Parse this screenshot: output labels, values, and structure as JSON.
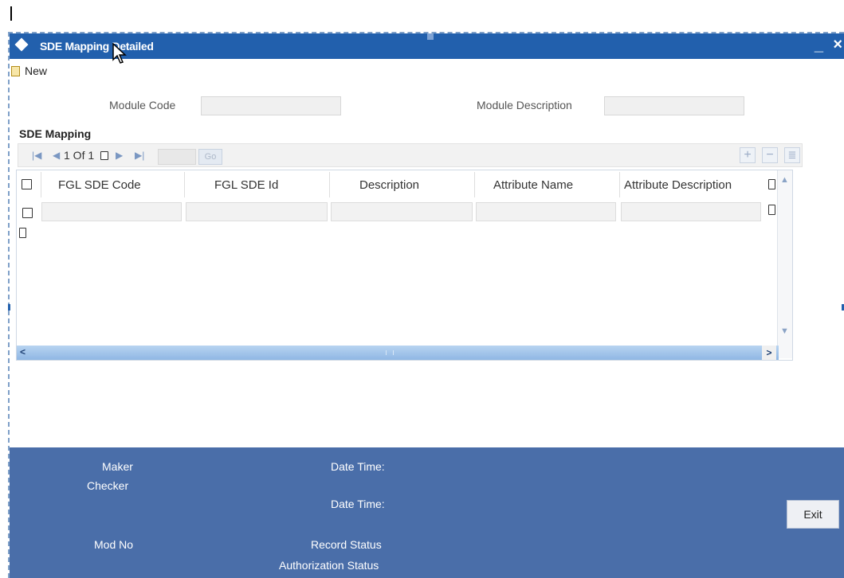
{
  "window": {
    "title": "SDE Mapping Detailed",
    "minimize": "_",
    "close": "×"
  },
  "toolbar": {
    "new_label": "New"
  },
  "form": {
    "module_code_label": "Module Code",
    "module_code_value": "",
    "module_description_label": "Module Description",
    "module_description_value": ""
  },
  "section": {
    "title": "SDE Mapping"
  },
  "pager": {
    "page_text": "1 Of 1",
    "page_input": "",
    "go_label": "Go",
    "add": "+",
    "remove": "−",
    "view": "≣"
  },
  "grid": {
    "columns": [
      "FGL SDE Code",
      "FGL SDE Id",
      "Description",
      "Attribute Name",
      "Attribute Description"
    ],
    "rows": [
      [
        "",
        "",
        "",
        "",
        ""
      ]
    ]
  },
  "footer": {
    "maker_label": "Maker",
    "checker_label": "Checker",
    "date_time_label_1": "Date Time:",
    "date_time_label_2": "Date Time:",
    "mod_no_label": "Mod No",
    "record_status_label": "Record Status",
    "authorization_status_label": "Authorization Status",
    "exit_label": "Exit"
  },
  "colors": {
    "title_bar": "#2260ad",
    "footer": "#4a6ea9",
    "scrollbar": "#a6c6ea"
  }
}
